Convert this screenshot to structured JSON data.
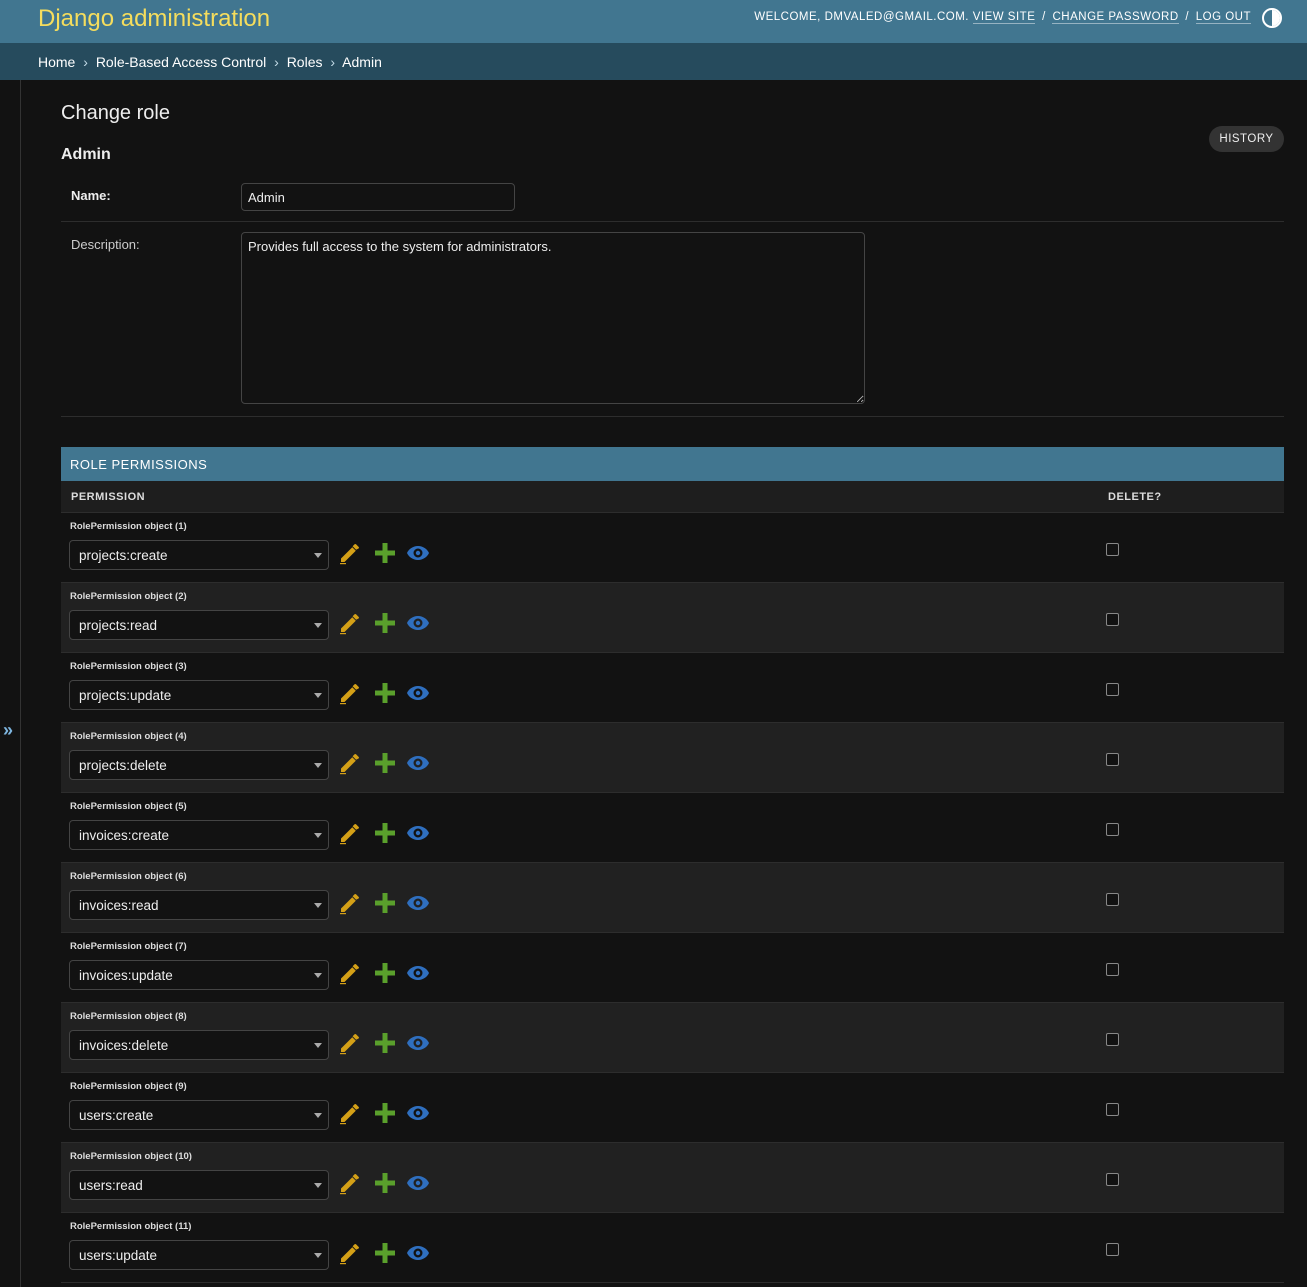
{
  "header": {
    "branding": "Django administration",
    "welcome": "WELCOME,",
    "user": "DMVALED@GMAIL.COM.",
    "view_site": "VIEW SITE",
    "change_password": "CHANGE PASSWORD",
    "log_out": "LOG OUT",
    "separator": "/"
  },
  "breadcrumbs": {
    "home": "Home",
    "app": "Role-Based Access Control",
    "model": "Roles",
    "current": "Admin",
    "arrow": "›"
  },
  "nav": {
    "toggle_glyph": "»"
  },
  "page": {
    "title": "Change role",
    "object_title": "Admin",
    "history_label": "HISTORY"
  },
  "form": {
    "name_label": "Name:",
    "name_value": "Admin",
    "description_label": "Description:",
    "description_value": "Provides full access to the system for administrators."
  },
  "inline": {
    "title": "ROLE PERMISSIONS",
    "col_permission": "PERMISSION",
    "col_delete": "DELETE?",
    "rows": [
      {
        "label": "RolePermission object (1)",
        "value": "projects:create",
        "delete": false
      },
      {
        "label": "RolePermission object (2)",
        "value": "projects:read",
        "delete": false
      },
      {
        "label": "RolePermission object (3)",
        "value": "projects:update",
        "delete": false
      },
      {
        "label": "RolePermission object (4)",
        "value": "projects:delete",
        "delete": false
      },
      {
        "label": "RolePermission object (5)",
        "value": "invoices:create",
        "delete": false
      },
      {
        "label": "RolePermission object (6)",
        "value": "invoices:read",
        "delete": false
      },
      {
        "label": "RolePermission object (7)",
        "value": "invoices:update",
        "delete": false
      },
      {
        "label": "RolePermission object (8)",
        "value": "invoices:delete",
        "delete": false
      },
      {
        "label": "RolePermission object (9)",
        "value": "users:create",
        "delete": false
      },
      {
        "label": "RolePermission object (10)",
        "value": "users:read",
        "delete": false
      },
      {
        "label": "RolePermission object (11)",
        "value": "users:update",
        "delete": false
      }
    ]
  },
  "icons": {
    "edit": "pencil-icon",
    "add": "plus-icon",
    "view": "eye-icon",
    "theme": "contrast-icon"
  },
  "colors": {
    "header_bg": "#417690",
    "branding": "#f5dd5d",
    "breadcrumb_bg": "#264b5d",
    "edit_icon": "#d4a017",
    "add_icon": "#5aa02c",
    "view_icon": "#2f6fbf"
  }
}
